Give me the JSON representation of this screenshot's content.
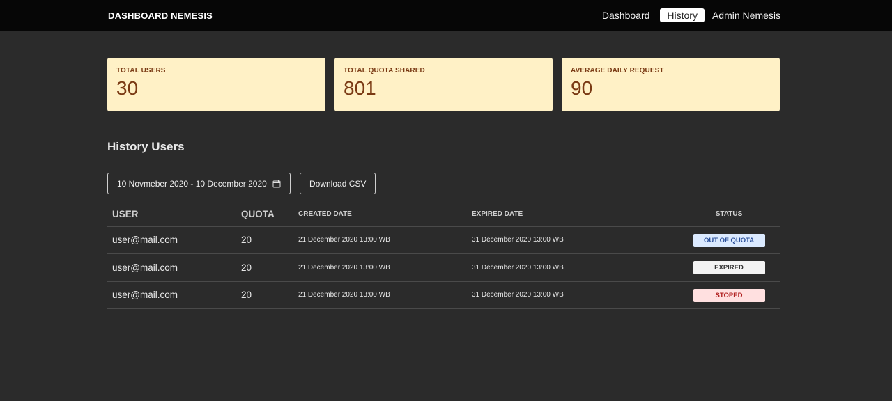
{
  "header": {
    "brand": "DASHBOARD NEMESIS",
    "nav": {
      "dashboard": "Dashboard",
      "history": "History",
      "admin": "Admin Nemesis"
    }
  },
  "stats": [
    {
      "label": "TOTAL USERS",
      "value": "30"
    },
    {
      "label": "TOTAL QUOTA SHARED",
      "value": "801"
    },
    {
      "label": "AVERAGE DAILY REQUEST",
      "value": "90"
    }
  ],
  "section_title": "History Users",
  "filters": {
    "date_range": "10 Novmeber 2020 - 10 December 2020",
    "download_label": "Download CSV"
  },
  "table": {
    "headers": {
      "user": "USER",
      "quota": "QUOTA",
      "created": "CREATED DATE",
      "expired": "EXPIRED DATE",
      "status": "STATUS"
    },
    "rows": [
      {
        "user": "user@mail.com",
        "quota": "20",
        "created": "21 December 2020 13:00 WB",
        "expired": "31 December 2020 13:00 WB",
        "status": "OUT OF QUOTA"
      },
      {
        "user": "user@mail.com",
        "quota": "20",
        "created": "21 December 2020 13:00 WB",
        "expired": "31 December 2020 13:00 WB",
        "status": "EXPIRED"
      },
      {
        "user": "user@mail.com",
        "quota": "20",
        "created": "21 December 2020 13:00 WB",
        "expired": "31 December 2020 13:00 WB",
        "status": "STOPED"
      }
    ]
  },
  "colors": {
    "background": "#2b2b2b",
    "topbar": "#060606",
    "card_bg": "#fff1c6",
    "card_text": "#7a3a14",
    "status_out_of_quota": "#dbeaff",
    "status_expired": "#f3f3f3",
    "status_stoped": "#ffe0e0"
  }
}
